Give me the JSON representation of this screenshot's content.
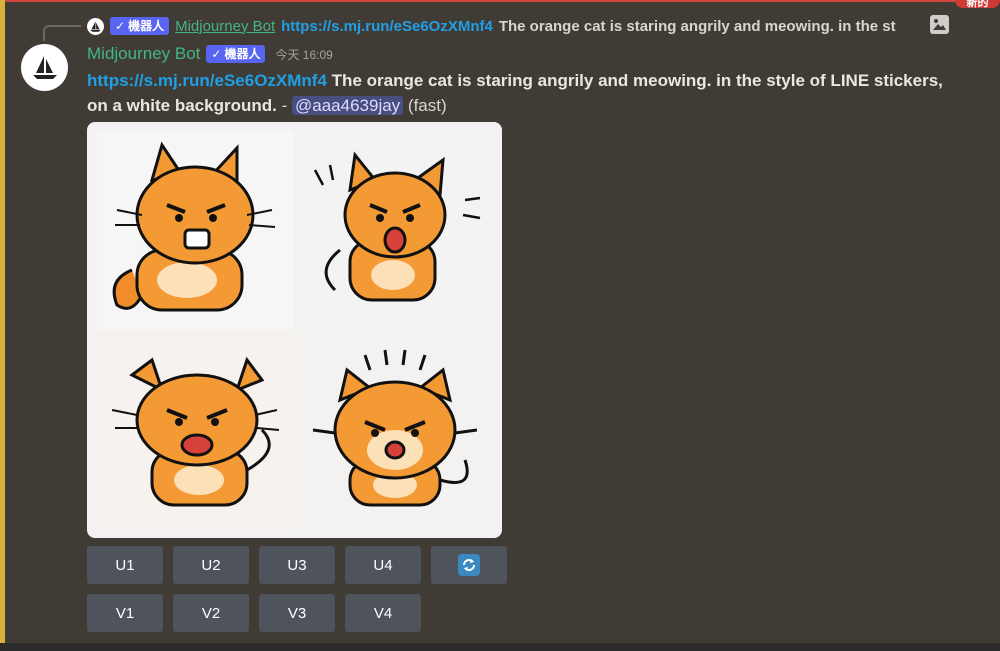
{
  "badge": {
    "label": "新的"
  },
  "reply": {
    "author": "Midjourney Bot",
    "bot_tag": "機器人",
    "link": "https://s.mj.run/eSe6OzXMnf4",
    "text": "The orange cat is staring angrily and meowing. in the st"
  },
  "message": {
    "author": "Midjourney Bot",
    "bot_tag": "機器人",
    "check": "✓",
    "timestamp": "今天 16:09",
    "link": "https://s.mj.run/eSe6OzXMnf4",
    "prompt": "The orange cat is staring angrily and meowing. in the style of LINE stickers, on a white background.",
    "separator": "-",
    "mention": "@aaa4639jay",
    "mode": "(fast)"
  },
  "image_grid": {
    "alt": "Four cartoon orange cat stickers"
  },
  "buttons": {
    "upscale": [
      "U1",
      "U2",
      "U3",
      "U4"
    ],
    "variation": [
      "V1",
      "V2",
      "V3",
      "V4"
    ],
    "reroll_icon": "refresh-icon"
  },
  "colors": {
    "background": "#403c35",
    "author": "#43b581",
    "link": "#1f9fe5",
    "bot_tag": "#5865f2",
    "button": "#4f545c",
    "highlight": "#d9b23e"
  }
}
